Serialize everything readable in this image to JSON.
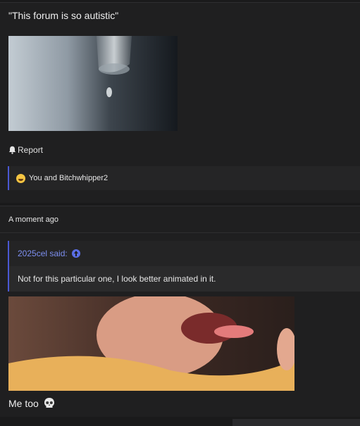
{
  "post1": {
    "quote_text": "\"This forum is so autistic\"",
    "report_label": "Report",
    "reactions_text": "You and Bitchwhipper2"
  },
  "post2": {
    "timestamp": "A moment ago",
    "quote_author": "2025cel said:",
    "quote_body": "Not for this particular one, I look better animated in it.",
    "reply_text": "Me too"
  },
  "icons": {
    "report": "bell-icon",
    "reaction": "laughing-emoji-icon",
    "quote_jump": "arrow-up-circle-icon",
    "reply_emoji": "skull-emoji-icon"
  },
  "colors": {
    "accent": "#4a58d4",
    "link": "#7d8ff0",
    "background": "#1a1a1b"
  }
}
